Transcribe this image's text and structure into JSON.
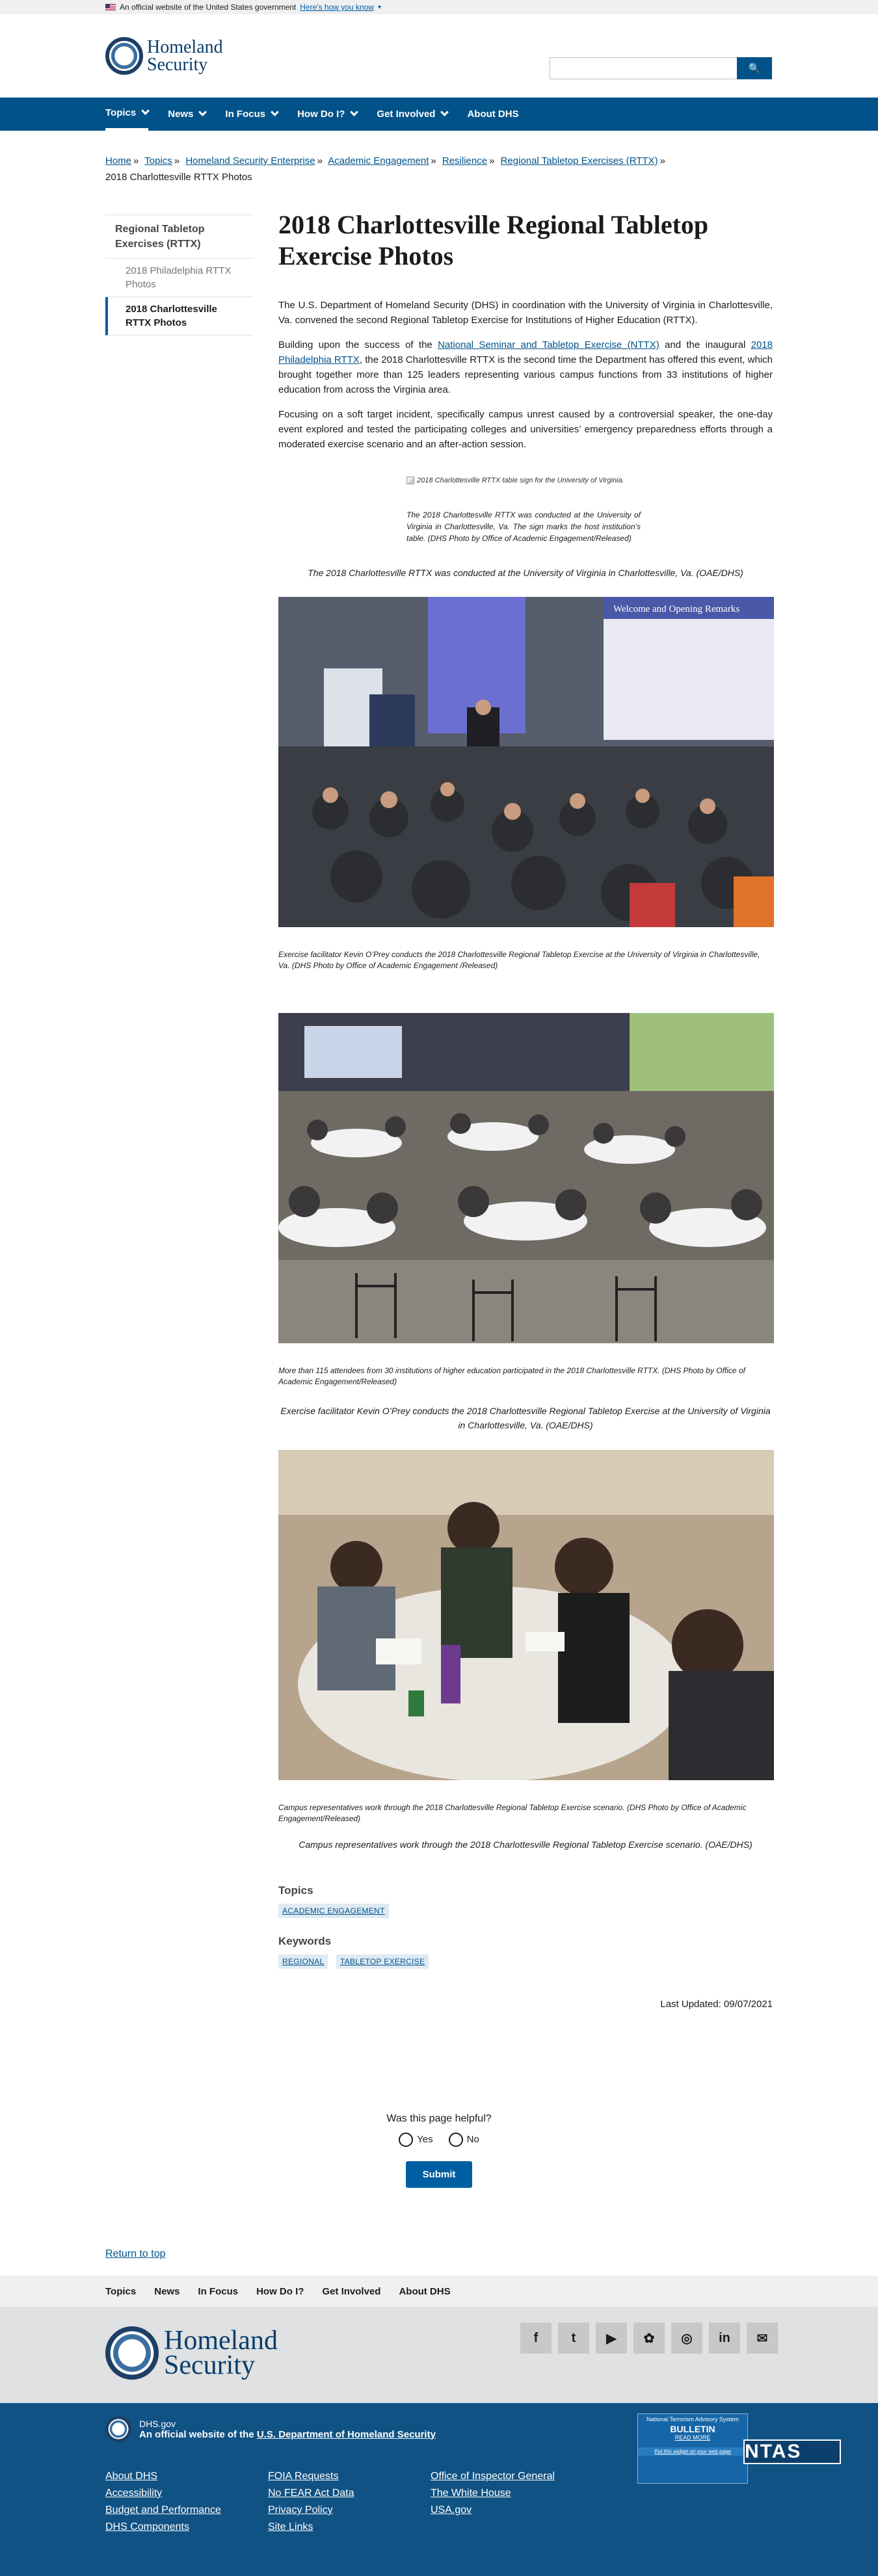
{
  "gov_banner": {
    "text": "An official website of the United States government",
    "link": "Here's how you know"
  },
  "header": {
    "logo_line1": "Homeland",
    "logo_line2": "Security",
    "search_placeholder": "",
    "search_button": "🔍"
  },
  "nav": [
    "Topics",
    "News",
    "In Focus",
    "How Do I?",
    "Get Involved",
    "About DHS"
  ],
  "breadcrumb": {
    "links": [
      "Home",
      "Topics",
      "Homeland Security Enterprise",
      "Academic Engagement",
      "Resilience",
      "Regional Tabletop Exercises (RTTX)"
    ],
    "current": "2018 Charlottesville RTTX Photos"
  },
  "sidenav": {
    "title": "Regional Tabletop Exercises (RTTX)",
    "items": [
      "2018 Philadelphia RTTX Photos",
      "2018 Charlottesville RTTX Photos"
    ]
  },
  "main": {
    "title": "2018 Charlottesville Regional Tabletop Exercise Photos",
    "p1": "The U.S. Department of Homeland Security (DHS) in coordination with the University of Virginia in Charlottesville, Va. convened the second Regional Tabletop Exercise for Institutions of Higher Education (RTTX).",
    "p2_a": "Building upon the success of the ",
    "p2_link1": "National Seminar and Tabletop Exercise (NTTX)",
    "p2_b": " and the inaugural ",
    "p2_link2": "2018 Philadelphia RTTX",
    "p2_c": ", the 2018 Charlottesville RTTX is the second time the Department has offered this event, which brought together more than 125 leaders representing various campus functions from 33 institutions of higher education from across the Virginia area.",
    "p3": "Focusing on a soft target incident, specifically campus unrest caused by a controversial speaker, the one-day event explored and tested the participating colleges and universities’ emergency preparedness efforts through a moderated exercise scenario and an after-action session.",
    "fig1_alt": "2018 Charlottesville RTTX table sign for the University of Virginia.",
    "fig1_caption": "The 2018 Charlottesville RTTX was conducted at the University of Virginia in Charlottesville, Va. The sign marks the host institution’s table.  (DHS Photo by Office of Academic Engagement/Released)",
    "fig1_center": "The 2018 Charlottesville RTTX was conducted at the University of Virginia in Charlottesville, Va. (OAE/DHS)",
    "slide_title": "Welcome and Opening Remarks",
    "photo1_caption": "Exercise facilitator Kevin O’Prey conducts the 2018 Charlottesville Regional Tabletop Exercise at the University of Virginia in Charlottesville, Va.  (DHS Photo by Office of Academic Engagement /Released)",
    "photo2_caption": "More than 115 attendees from 30 institutions of higher education participated in the 2018 Charlottesville RTTX.  (DHS Photo by Office of Academic Engagement/Released)",
    "photo2_center": "Exercise facilitator Kevin O’Prey conducts the 2018 Charlottesville Regional Tabletop Exercise at the University of Virginia in Charlottesville, Va. (OAE/DHS)",
    "photo3_caption": "Campus representatives work through the 2018 Charlottesville Regional Tabletop Exercise scenario.  (DHS Photo by Office of Academic Engagement/Released)",
    "photo3_center": "Campus representatives work through the 2018 Charlottesville Regional Tabletop Exercise scenario. (OAE/DHS)"
  },
  "topics": {
    "heading": "Topics",
    "tags": [
      "ACADEMIC ENGAGEMENT"
    ]
  },
  "keywords": {
    "heading": "Keywords",
    "tags": [
      "REGIONAL",
      "TABLETOP EXERCISE"
    ]
  },
  "last_updated": "Last Updated: 09/07/2021",
  "feedback": {
    "question": "Was this page helpful?",
    "yes": "Yes",
    "no": "No",
    "submit": "Submit"
  },
  "return_top": "Return to top",
  "footer_nav": [
    "Topics",
    "News",
    "In Focus",
    "How Do I?",
    "Get Involved",
    "About DHS"
  ],
  "footer_logo": {
    "line1": "Homeland",
    "line2": "Security"
  },
  "social": [
    "f",
    "t",
    "▶",
    "✿",
    "◎",
    "in",
    "✉"
  ],
  "identifier": {
    "domain": "DHS.gov",
    "official_prefix": "An official website of the ",
    "official_link": "U.S. Department of Homeland Security"
  },
  "footer_links": [
    "About DHS",
    "FOIA Requests",
    "Office of Inspector General",
    "Accessibility",
    "No FEAR Act Data",
    "The White House",
    "Budget and Performance",
    "Privacy Policy",
    "USA.gov",
    "DHS Components",
    "Site Links"
  ],
  "ntas": {
    "line1": "National Terrorism Advisory System",
    "logo": "NTAS",
    "bulletin": "BULLETIN",
    "read_more": "READ MORE",
    "widget": "Put this widget on your web page"
  },
  "colors": {
    "primary": "#005288",
    "footer": "#115284",
    "nav_text": "#ffffff"
  }
}
